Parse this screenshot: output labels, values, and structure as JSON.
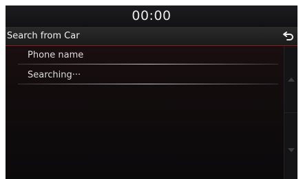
{
  "status": {
    "time": "00:00"
  },
  "header": {
    "title": "Search from Car",
    "back_icon": "back-arrow-icon"
  },
  "list": {
    "items": [
      {
        "label": "Phone name"
      },
      {
        "label": "Searching···"
      }
    ]
  },
  "scrollbar": {
    "up_icon": "triangle-up-icon",
    "down_icon": "triangle-down-icon"
  },
  "colors": {
    "background": "#0c0b0c",
    "title_bar": "#232324",
    "accent": "#6a2a2a",
    "text": "#f1f1f1"
  }
}
